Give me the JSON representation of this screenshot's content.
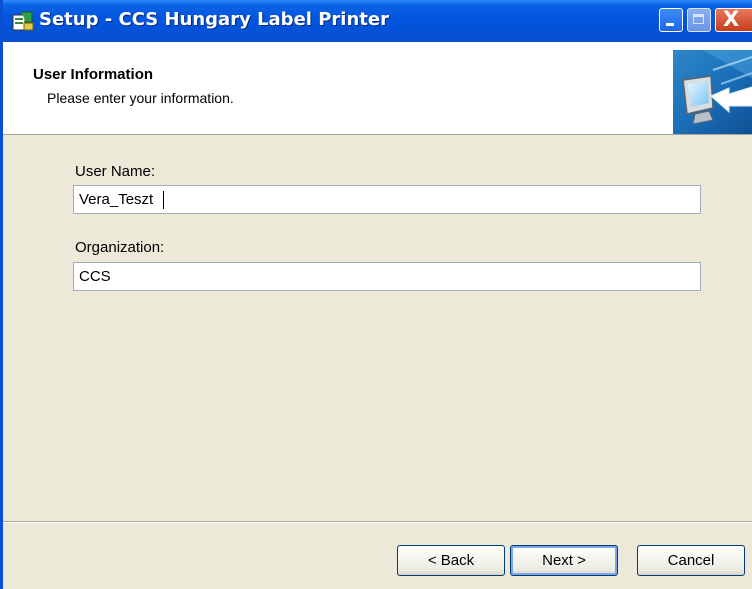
{
  "window": {
    "title": "Setup - CCS Hungary Label Printer",
    "controls": {
      "minimize_icon": "minimize-icon",
      "maximize_icon": "maximize-icon",
      "close_icon": "close-icon",
      "close_glyph": "X"
    }
  },
  "header": {
    "title": "User Information",
    "subtitle": "Please enter your information.",
    "graphic_icon": "computer-arrow-icon"
  },
  "form": {
    "user_name_label": "User Name:",
    "user_name_value": "Vera_Teszt",
    "organization_label": "Organization:",
    "organization_value": "CCS"
  },
  "buttons": {
    "back_label": "< Back",
    "next_label": "Next >",
    "cancel_label": "Cancel"
  },
  "colors": {
    "titlebar_accent": "#0456e0",
    "close_button": "#c43d1c",
    "dialog_background": "#ece9d8"
  }
}
